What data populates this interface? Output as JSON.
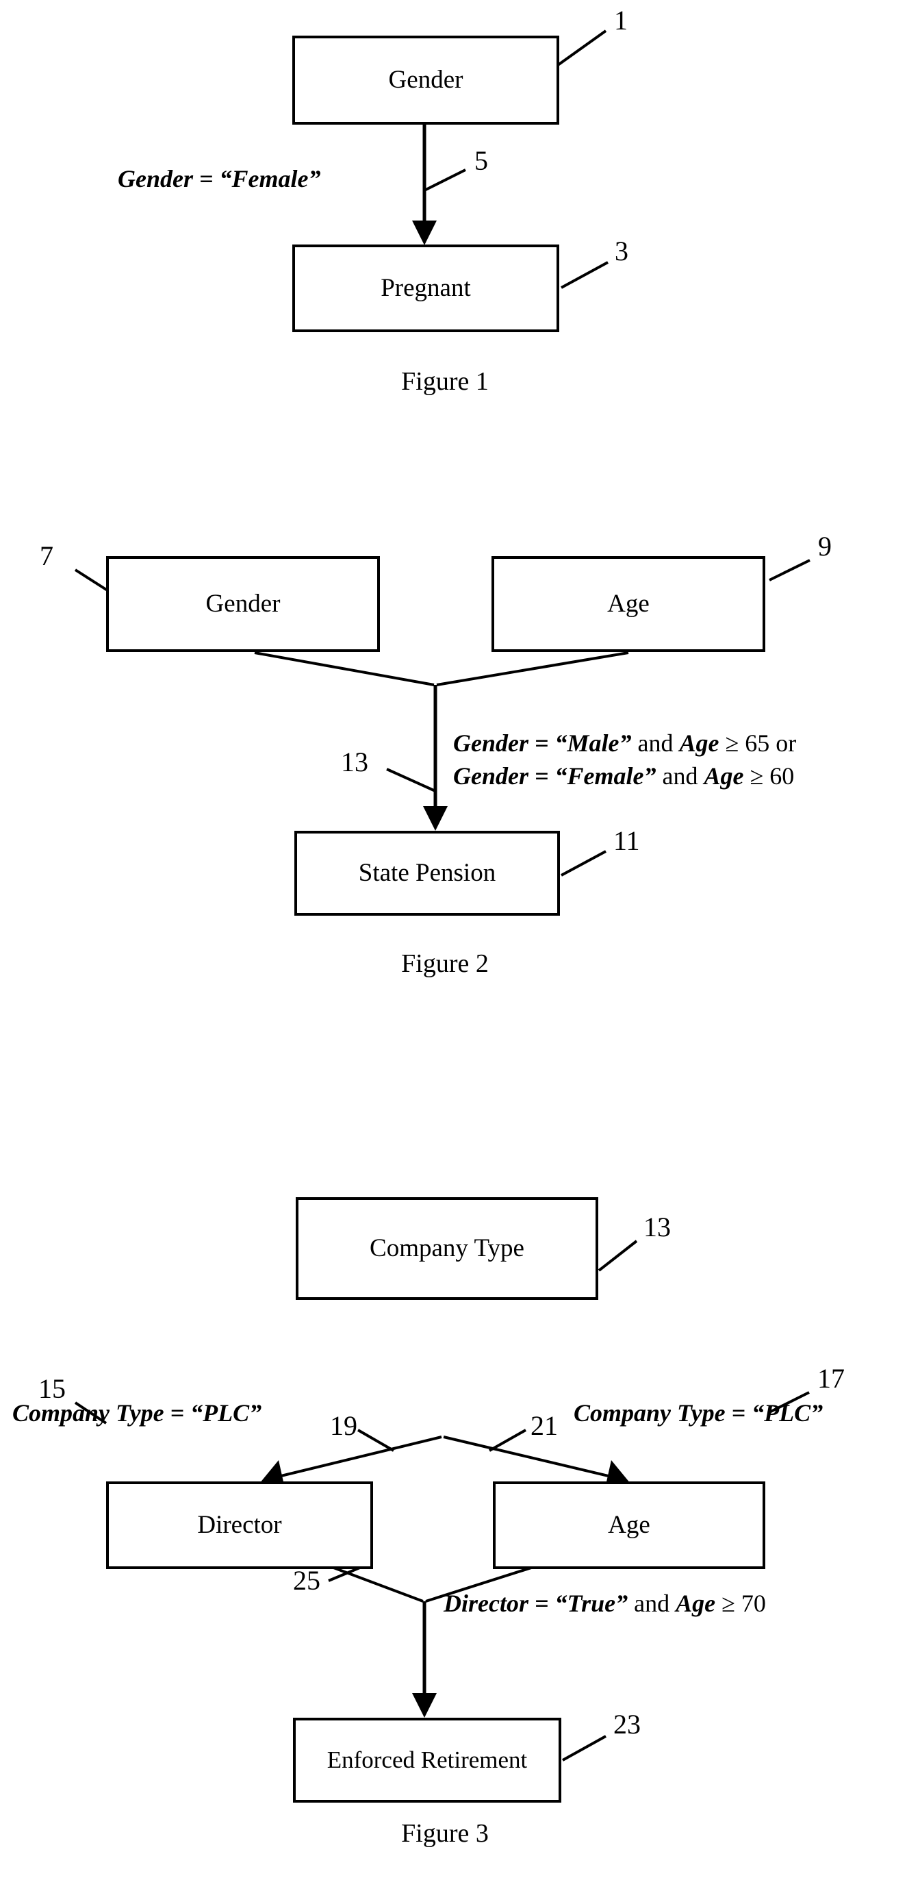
{
  "document": {
    "type": "patent-drawing-sheet",
    "background_color": "#ffffff",
    "ink_color": "#000000"
  },
  "figures": [
    {
      "caption": "Figure 1",
      "nodes": [
        {
          "label": "Gender",
          "ref": "1"
        },
        {
          "label": "Pregnant",
          "ref": "3"
        }
      ],
      "edges": [
        {
          "ref": "5",
          "from": "Gender",
          "to": "Pregnant",
          "condition_plain": "Gender = “Female”",
          "condition_parts": [
            {
              "text": "Gender = “Female”",
              "style": "bold-italic"
            }
          ]
        }
      ]
    },
    {
      "caption": "Figure 2",
      "nodes": [
        {
          "label": "Gender",
          "ref": "7"
        },
        {
          "label": "Age",
          "ref": "9"
        },
        {
          "label": "State Pension",
          "ref": "11"
        }
      ],
      "edges": [
        {
          "ref": "13",
          "from": [
            "Gender",
            "Age"
          ],
          "to": "State Pension",
          "condition_plain": "Gender = “Male” and Age ≥ 65 or Gender = “Female” and Age ≥ 60",
          "condition_lines": [
            [
              {
                "text": "Gender = “Male” ",
                "style": "bold-italic"
              },
              {
                "text": "and ",
                "style": "roman"
              },
              {
                "text": "Age ",
                "style": "bold-italic"
              },
              {
                "text": "≥ 65 ",
                "style": "roman"
              },
              {
                "text": "or",
                "style": "roman"
              }
            ],
            [
              {
                "text": "Gender = “Female” ",
                "style": "bold-italic"
              },
              {
                "text": "and ",
                "style": "roman"
              },
              {
                "text": "Age ",
                "style": "bold-italic"
              },
              {
                "text": "≥ 60",
                "style": "roman"
              }
            ]
          ]
        }
      ]
    },
    {
      "caption": "Figure 3",
      "nodes": [
        {
          "label": "Company Type",
          "ref": "13"
        },
        {
          "label": "Director",
          "ref": "15"
        },
        {
          "label": "Age",
          "ref": "17"
        },
        {
          "label": "Enforced Retirement",
          "ref": "23"
        }
      ],
      "edges": [
        {
          "ref": "19",
          "from": "Company Type",
          "to": "Director",
          "condition_plain": "Company Type = “PLC”",
          "condition_parts": [
            {
              "text": "Company Type = “PLC”",
              "style": "bold-italic"
            }
          ]
        },
        {
          "ref": "21",
          "from": "Company Type",
          "to": "Age",
          "condition_plain": "Company Type = “PLC”",
          "condition_parts": [
            {
              "text": "Company Type = “PLC”",
              "style": "bold-italic"
            }
          ]
        },
        {
          "ref": "25",
          "from": [
            "Director",
            "Age"
          ],
          "to": "Enforced Retirement",
          "condition_plain": "Director = “True” and Age ≥ 70",
          "condition_parts": [
            {
              "text": "Director = “True” ",
              "style": "bold-italic"
            },
            {
              "text": "and ",
              "style": "roman"
            },
            {
              "text": "Age ",
              "style": "bold-italic"
            },
            {
              "text": "≥ 70",
              "style": "roman"
            }
          ]
        }
      ]
    }
  ],
  "fig1": {
    "node_gender": "Gender",
    "node_pregnant": "Pregnant",
    "ref_gender": "1",
    "ref_pregnant": "3",
    "ref_edge": "5",
    "cond_female": "Gender = “Female”",
    "caption": "Figure 1"
  },
  "fig2": {
    "node_gender": "Gender",
    "node_age": "Age",
    "node_pension": "State Pension",
    "ref_gender": "7",
    "ref_age": "9",
    "ref_pension": "11",
    "ref_edge": "13",
    "cond_line1_a": "Gender = “Male”",
    "cond_line1_b": "and",
    "cond_line1_c": "Age",
    "cond_line1_d": "≥ 65 or",
    "cond_line2_a": "Gender = “Female”",
    "cond_line2_b": "and",
    "cond_line2_c": "Age",
    "cond_line2_d": "≥ 60",
    "caption": "Figure 2"
  },
  "fig3": {
    "node_company": "Company Type",
    "node_director": "Director",
    "node_age": "Age",
    "node_retirement": "Enforced Retirement",
    "ref_company": "13",
    "ref_director": "15",
    "ref_age": "17",
    "ref_retirement": "23",
    "ref_edge_left": "19",
    "ref_edge_right": "21",
    "ref_edge_join": "25",
    "cond_left": "Company Type = “PLC”",
    "cond_right": "Company Type = “PLC”",
    "cond_join_a": "Director = “True”",
    "cond_join_b": "and",
    "cond_join_c": "Age",
    "cond_join_d": "≥ 70",
    "caption": "Figure 3"
  }
}
